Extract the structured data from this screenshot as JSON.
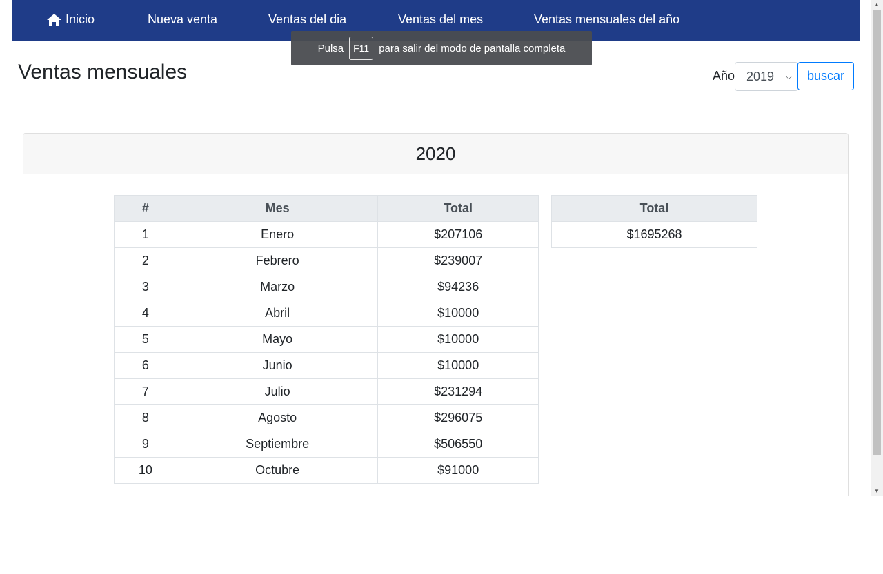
{
  "navbar": {
    "items": [
      {
        "label": "Inicio",
        "icon": "home-icon"
      },
      {
        "label": "Nueva venta"
      },
      {
        "label": "Ventas del dia"
      },
      {
        "label": "Ventas del mes"
      },
      {
        "label": "Ventas mensuales del año"
      }
    ],
    "color": "#1f3c88"
  },
  "fullscreen_toast": {
    "before": "Pulsa",
    "key": "F11",
    "after": "para salir del modo de pantalla completa"
  },
  "header": {
    "title": "Ventas mensuales",
    "year_label": "Año",
    "year_selected": "2019",
    "search_label": "buscar"
  },
  "card": {
    "title": "2020"
  },
  "months_table": {
    "headers": [
      "#",
      "Mes",
      "Total"
    ],
    "rows": [
      [
        "1",
        "Enero",
        "$207106"
      ],
      [
        "2",
        "Febrero",
        "$239007"
      ],
      [
        "3",
        "Marzo",
        "$94236"
      ],
      [
        "4",
        "Abril",
        "$10000"
      ],
      [
        "5",
        "Mayo",
        "$10000"
      ],
      [
        "6",
        "Junio",
        "$10000"
      ],
      [
        "7",
        "Julio",
        "$231294"
      ],
      [
        "8",
        "Agosto",
        "$296075"
      ],
      [
        "9",
        "Septiembre",
        "$506550"
      ],
      [
        "10",
        "Octubre",
        "$91000"
      ]
    ]
  },
  "total_table": {
    "header": "Total",
    "value": "$1695268"
  }
}
